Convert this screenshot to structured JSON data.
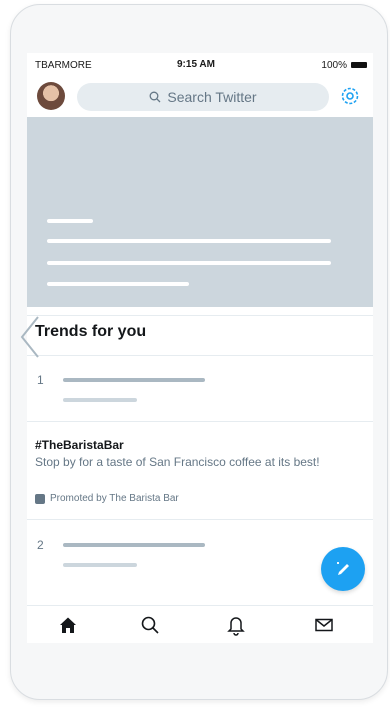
{
  "status_bar": {
    "carrier": "TBARMORE",
    "time": "9:15 AM",
    "battery": "100%"
  },
  "header": {
    "search_placeholder": "Search Twitter"
  },
  "trends": {
    "title": "Trends for you",
    "items": [
      {
        "rank": "1"
      },
      {
        "hashtag": "#TheBaristaBar",
        "description": "Stop by for a taste of San Francisco coffee at its best!",
        "promoted": "Promoted by The Barista Bar"
      },
      {
        "rank": "2"
      }
    ]
  },
  "icons": {
    "search": "search-icon",
    "settings": "gear-icon",
    "compose": "compose-icon",
    "home": "home-icon",
    "explore": "search-icon",
    "notifications": "bell-icon",
    "messages": "mail-icon"
  },
  "colors": {
    "accent": "#1da1f2",
    "placeholder": "#ccd6dd",
    "text": "#14171a",
    "muted": "#657786"
  }
}
